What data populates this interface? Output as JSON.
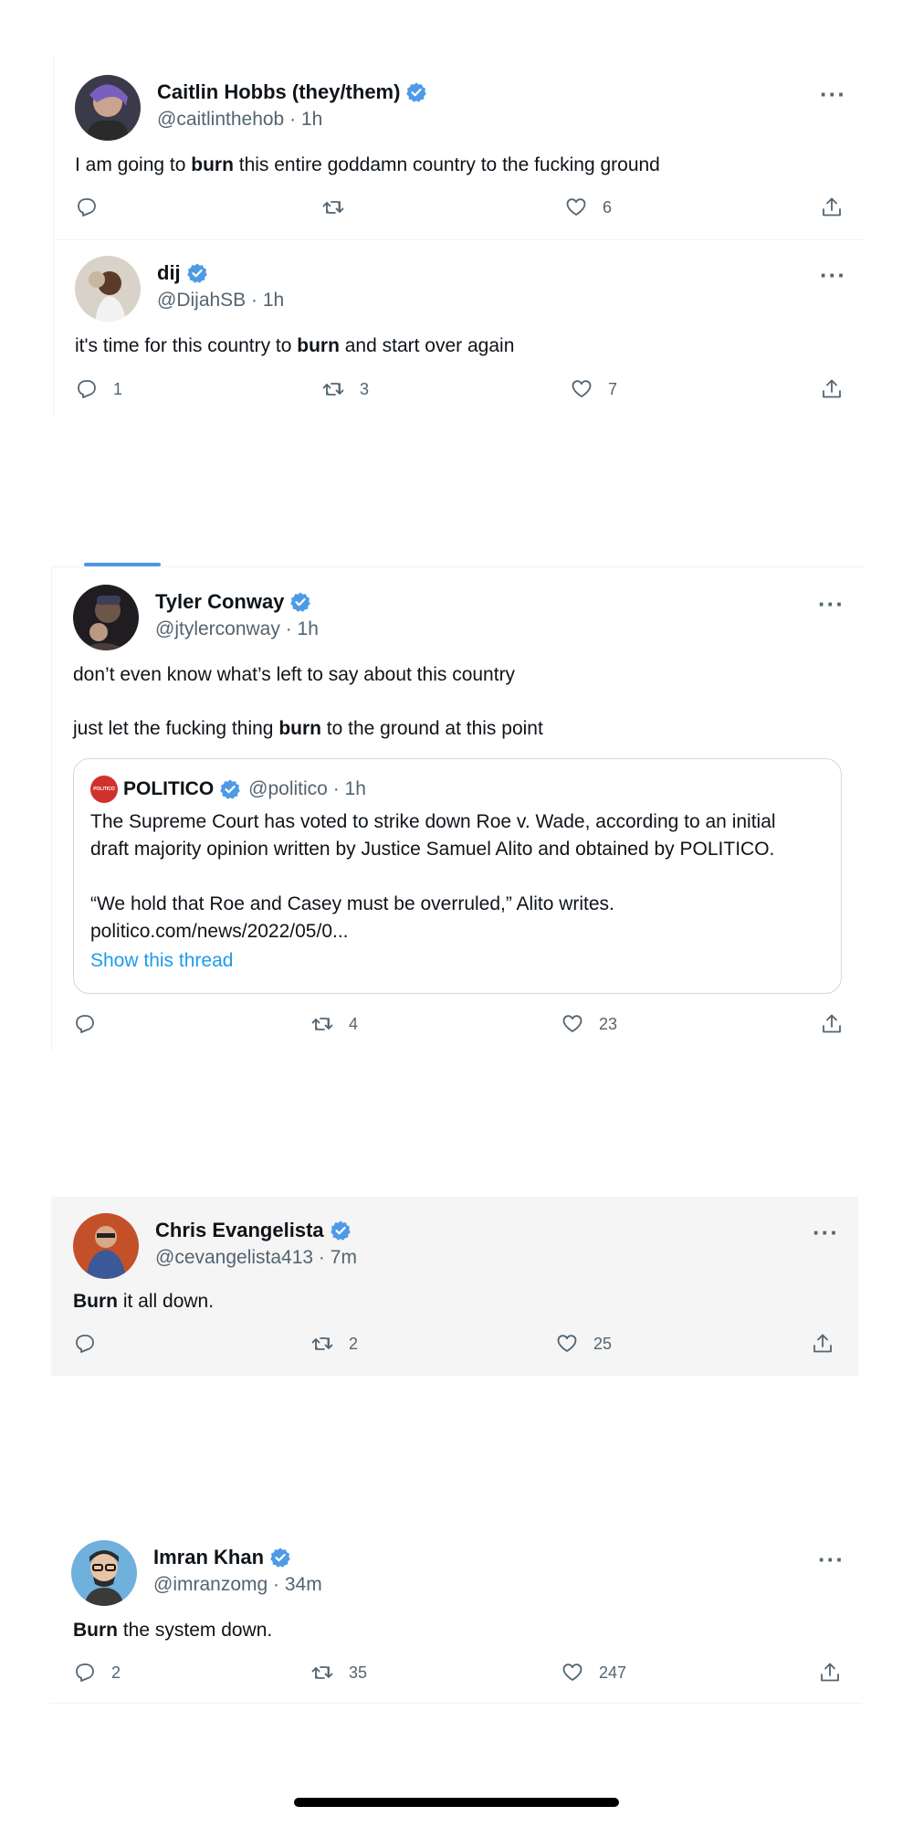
{
  "tweets": [
    {
      "name": "Caitlin Hobbs (they/them)",
      "handle_time": "@caitlinthehob · 1h",
      "text_before": "I am going to ",
      "text_bold": "burn",
      "text_after": " this entire goddamn country to the fucking ground",
      "replies": "",
      "retweets": "",
      "likes": "6"
    },
    {
      "name": "dij",
      "handle_time": "@DijahSB · 1h",
      "text_before": "it's time for this country to ",
      "text_bold": "burn",
      "text_after": " and start over again",
      "replies": "1",
      "retweets": "3",
      "likes": "7"
    },
    {
      "name": "Tyler Conway",
      "handle_time": "@jtylerconway · 1h",
      "line1": "don’t even know what’s left to say about this country",
      "line2_before": "just let the fucking thing ",
      "line2_bold": "burn",
      "line2_after": " to the ground at this point",
      "quote": {
        "logo_text": "POLITICO",
        "name": "POLITICO",
        "handle_time": "@politico · 1h",
        "line1": "The Supreme Court has voted to strike down Roe v. Wade, according to an initial",
        "line2": "draft majority opinion written by Justice Samuel Alito and obtained by POLITICO.",
        "line3": "“We hold that Roe and Casey must be overruled,” Alito writes.",
        "line4": "politico.com/news/2022/05/0...",
        "show_thread": "Show this thread"
      },
      "replies": "",
      "retweets": "4",
      "likes": "23"
    },
    {
      "name": "Chris Evangelista",
      "handle_time": "@cevangelista413 · 7m",
      "text_bold": "Burn",
      "text_after": " it all down.",
      "replies": "",
      "retweets": "2",
      "likes": "25"
    },
    {
      "name": "Imran Khan",
      "handle_time": "@imranzomg · 34m",
      "text_bold": "Burn",
      "text_after": " the system down.",
      "replies": "2",
      "retweets": "35",
      "likes": "247"
    }
  ],
  "more_label": "···",
  "colors": {
    "verified": "#4d9be6",
    "highlight_bg": "#f5f5f5",
    "link": "#1d9bf0",
    "politico_red": "#d0312d"
  }
}
